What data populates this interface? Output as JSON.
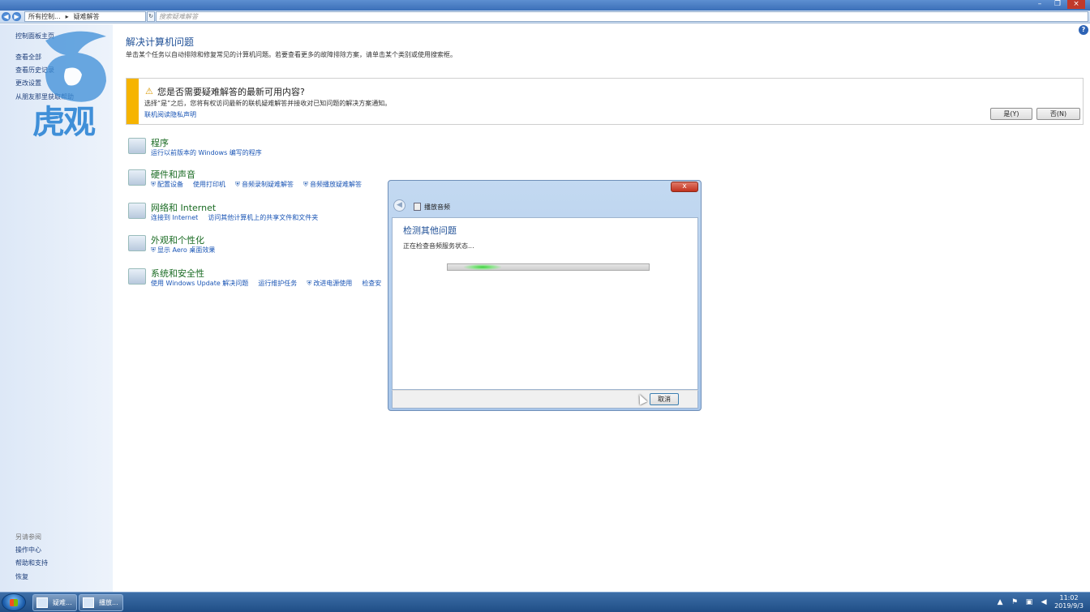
{
  "window": {
    "minimize": "–",
    "maximize": "❐",
    "close": "×"
  },
  "address": {
    "back": "◀",
    "forward": "▶",
    "crumbs": [
      "所有控制...",
      "疑难解答"
    ],
    "sep": "▸",
    "search_placeholder": "搜索疑难解答",
    "refresh": "↻"
  },
  "sidebar": {
    "items": [
      "控制面板主页",
      "查看全部",
      "查看历史记录",
      "更改设置",
      "从朋友那里获取帮助"
    ],
    "see_also": "另请参阅",
    "links": [
      "操作中心",
      "帮助和支持",
      "恢复"
    ]
  },
  "watermark": {
    "text": "虎观"
  },
  "main": {
    "title": "解决计算机问题",
    "description": "单击某个任务以自动排除和修复常见的计算机问题。若要查看更多的故障排除方案，请单击某个类别或使用搜索框。",
    "help": "?"
  },
  "infobar": {
    "warn_icon": "⚠",
    "question": "您是否需要疑难解答的最新可用内容?",
    "description": "选择“是”之后，您将有权访问最新的联机疑难解答并接收对已知问题的解决方案通知。",
    "link": "联机阅读隐私声明",
    "yes": "是(Y)",
    "no": "否(N)"
  },
  "categories": [
    {
      "title": "程序",
      "links": [
        "运行以前版本的 Windows 编写的程序"
      ]
    },
    {
      "title": "硬件和声音",
      "links": [
        "配置设备",
        "使用打印机",
        "音频录制疑难解答",
        "音频播放疑难解答"
      ]
    },
    {
      "title": "网络和 Internet",
      "links": [
        "连接到 Internet",
        "访问其他计算机上的共享文件和文件夹"
      ]
    },
    {
      "title": "外观和个性化",
      "links": [
        "显示 Aero 桌面效果"
      ]
    },
    {
      "title": "系统和安全性",
      "links": [
        "使用 Windows Update 解决问题",
        "运行维护任务",
        "改进电源使用",
        "检查安"
      ]
    }
  ],
  "dialog": {
    "close": "x",
    "back": "◀",
    "app_title": "播放音频",
    "heading": "检测其他问题",
    "status": "正在检查音频服务状态...",
    "progress": 0.12,
    "cancel": "取消"
  },
  "taskbar": {
    "tasks": [
      "疑难...",
      "播放..."
    ],
    "clock_time": "11:02",
    "clock_date": "2019/9/3",
    "tray_up": "▲",
    "tray_flag": "⚑",
    "tray_net": "▣",
    "tray_vol": "◀"
  }
}
